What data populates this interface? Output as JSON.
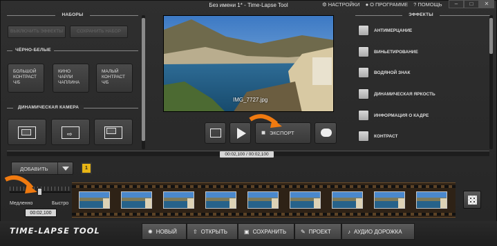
{
  "window": {
    "title": "Без имени 1* - Time-Lapse Tool",
    "links": [
      "НАСТРОЙКИ",
      "О ПРОГРАММЕ",
      "ПОМОЩЬ"
    ]
  },
  "left_panel": {
    "presets_heading": "НАБОРЫ",
    "disable_effects": "ВЫКЛЮЧИТЬ ЭФФЕКТЫ",
    "save_preset": "СОХРАНИТЬ НАБОР",
    "bw_heading": "ЧЁРНО-БЕЛЫЕ",
    "bw_buttons": [
      "БОЛЬШОЙ\nКОНТРАСТ\nЧ/Б",
      "КИНО\nЧАРЛИ\nЧАПЛИНА",
      "МАЛЫЙ\nКОНТРАСТ\nЧ/Б"
    ],
    "camera_heading": "ДИНАМИЧЕСКАЯ КАМЕРА"
  },
  "effects": {
    "heading": "ЭФФЕКТЫ",
    "items": [
      "АНТИМЕРЦАНИЕ",
      "ВИНЬЕТИРОВАНИЕ",
      "ВОДЯНОЙ ЗНАК",
      "ДИНАМИЧЕСКАЯ ЯРКОСТЬ",
      "ИНФОРМАЦИЯ О КАДРЕ",
      "КОНТРАСТ"
    ]
  },
  "preview": {
    "filename": "IMG_7727.jpg"
  },
  "controls": {
    "export_label": "ЭКСПОРТ",
    "time": "00:02,100 / 00:02,100"
  },
  "timeline": {
    "add_label": "ДОБАВИТЬ",
    "badge": "1",
    "slow": "Медленно",
    "fast": "Быстро",
    "duration": "00:02,100",
    "frame_count": 9
  },
  "bottom": {
    "logo": "TIME-LAPSE TOOL",
    "buttons": [
      "НОВЫЙ",
      "ОТКРЫТЬ",
      "СОХРАНИТЬ",
      "ПРОЕКТ",
      "АУДИО ДОРОЖКА"
    ]
  },
  "colors": {
    "accent": "#e8b515",
    "arrow": "#f07a10"
  }
}
